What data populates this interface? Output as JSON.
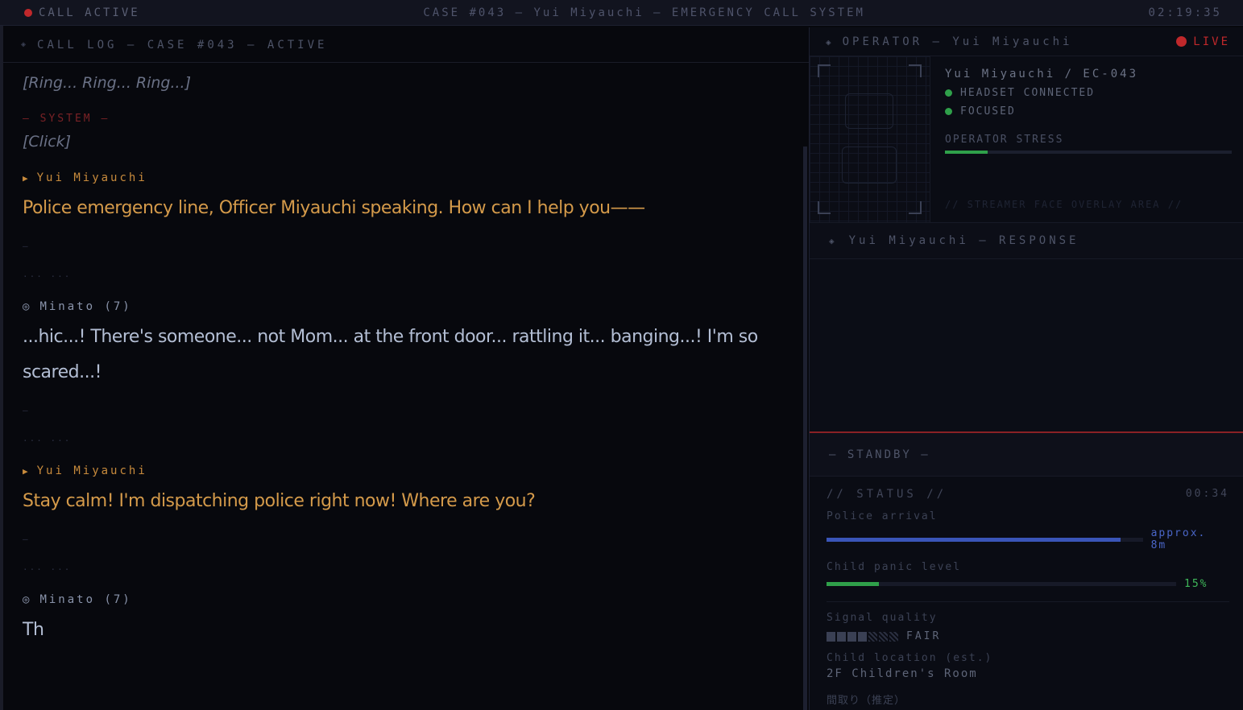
{
  "topbar": {
    "status": "CALL ACTIVE",
    "title": "CASE #043 — Yui Miyauchi — EMERGENCY CALL SYSTEM",
    "clock": "02:19:35"
  },
  "log": {
    "header": "CALL LOG — CASE #043 — ACTIVE",
    "ring": "[Ring... Ring... Ring...]",
    "system_label": "— SYSTEM —",
    "click": "[Click]",
    "dash": "—",
    "dots": "... ...",
    "entries": [
      {
        "speaker": "Yui Miyauchi",
        "text": "Police emergency line, Officer Miyauchi speaking. How can I help you——"
      },
      {
        "speaker": "Minato (7)",
        "text": "...hic...! There's someone... not Mom... at the front door... rattling it... banging...! I'm so scared...!"
      },
      {
        "speaker": "Yui Miyauchi",
        "text": "Stay calm! I'm dispatching police right now! Where are you?"
      },
      {
        "speaker": "Minato (7)",
        "text": "Th"
      }
    ]
  },
  "operator": {
    "header": "OPERATOR — Yui Miyauchi",
    "live": "LIVE",
    "name_id": "Yui Miyauchi / EC-043",
    "statuses": [
      "HEADSET CONNECTED",
      "FOCUSED"
    ],
    "stress_label": "OPERATOR STRESS",
    "stress": 0.15,
    "overlay_note": "// STREAMER FACE OVERLAY AREA //"
  },
  "response": {
    "header": "Yui Miyauchi — RESPONSE"
  },
  "standby": "— STANDBY —",
  "status": {
    "header": "// STATUS //",
    "time": "00:34",
    "police_label": "Police arrival",
    "police_progress": 0.93,
    "police_value": "approx. 8m",
    "panic_label": "Child panic level",
    "panic_progress": 0.15,
    "panic_value": "15%",
    "signal_label": "Signal quality",
    "signal_bars_filled": 4,
    "signal_bars_total": 7,
    "signal_value": "FAIR",
    "location_label": "Child location (est.)",
    "location_value": "2F Children's Room",
    "floorplan_label": "間取り（推定）"
  },
  "colors": {
    "operator": "#d49a4a",
    "caller": "#b3bed4",
    "live_red": "#c0282b",
    "status_green": "#2fa04a",
    "police_blue": "#3a55b8"
  }
}
